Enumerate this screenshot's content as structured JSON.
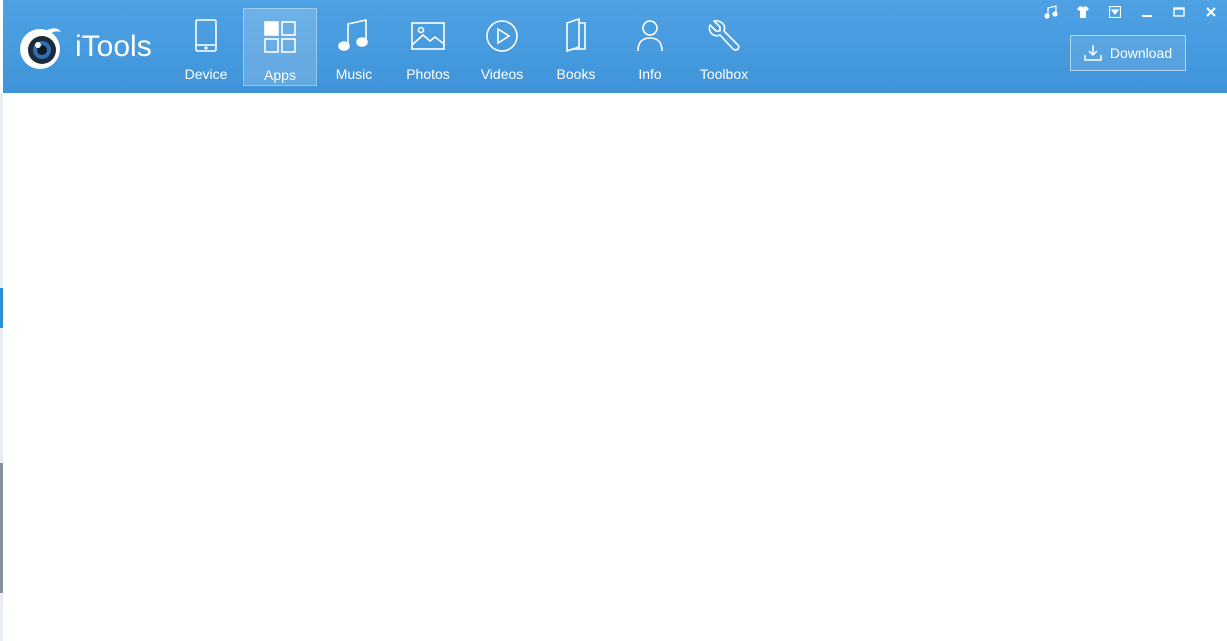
{
  "app": {
    "name": "iTools",
    "accent_color": "#3f93d8"
  },
  "nav": {
    "active": "apps",
    "items": [
      {
        "id": "device",
        "label": "Device",
        "icon": "device-icon"
      },
      {
        "id": "apps",
        "label": "Apps",
        "icon": "apps-grid-icon"
      },
      {
        "id": "music",
        "label": "Music",
        "icon": "music-note-icon"
      },
      {
        "id": "photos",
        "label": "Photos",
        "icon": "photo-icon"
      },
      {
        "id": "videos",
        "label": "Videos",
        "icon": "play-circle-icon"
      },
      {
        "id": "books",
        "label": "Books",
        "icon": "book-icon"
      },
      {
        "id": "info",
        "label": "Info",
        "icon": "person-icon"
      },
      {
        "id": "toolbox",
        "label": "Toolbox",
        "icon": "wrench-icon"
      }
    ]
  },
  "toolbar": {
    "download_label": "Download"
  },
  "window_controls": [
    "music-note-icon",
    "shirt-icon",
    "dropdown-icon",
    "minimize-icon",
    "maximize-icon",
    "close-icon"
  ]
}
